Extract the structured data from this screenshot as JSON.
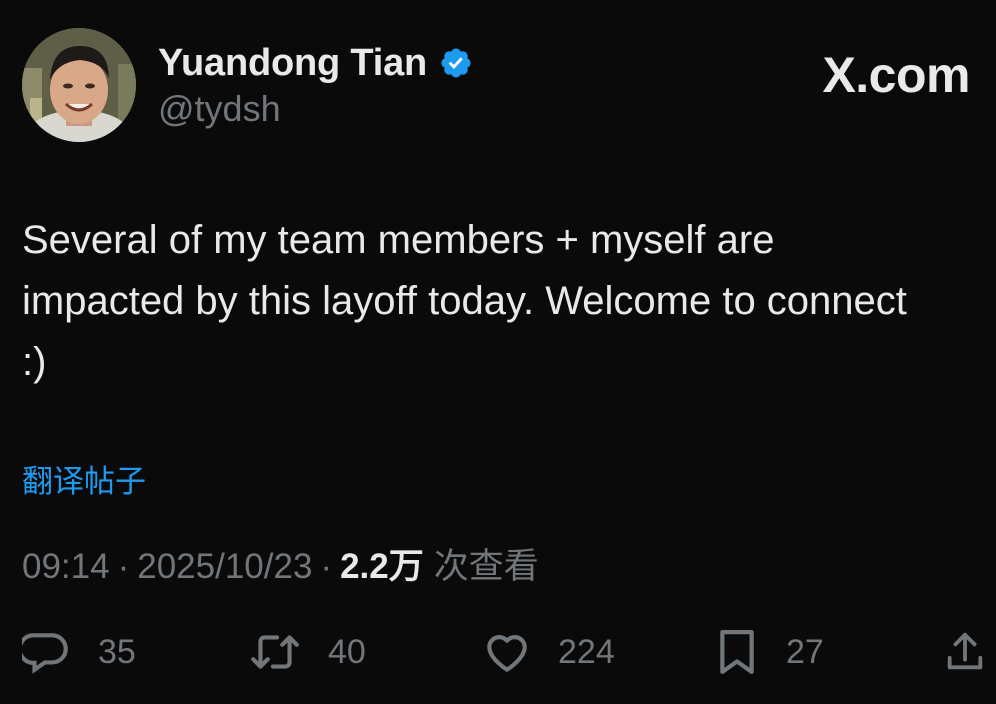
{
  "author": {
    "display_name": "Yuandong Tian",
    "handle": "@tydsh",
    "verified": true
  },
  "brand": {
    "label": "X.com"
  },
  "tweet": {
    "text": "Several of my team members + myself are impacted by this layoff today. Welcome to connect :)",
    "translate_label": "翻译帖子",
    "time": "09:14",
    "separator": "·",
    "date": "2025/10/23",
    "views_count": "2.2万",
    "views_label": "次查看"
  },
  "actions": {
    "reply_count": "35",
    "retweet_count": "40",
    "like_count": "224",
    "bookmark_count": "27"
  },
  "colors": {
    "background": "#0a0a0a",
    "text": "#e7e9ea",
    "secondary": "#71767b",
    "link": "#1d9bf0",
    "verified": "#1d9bf0"
  }
}
